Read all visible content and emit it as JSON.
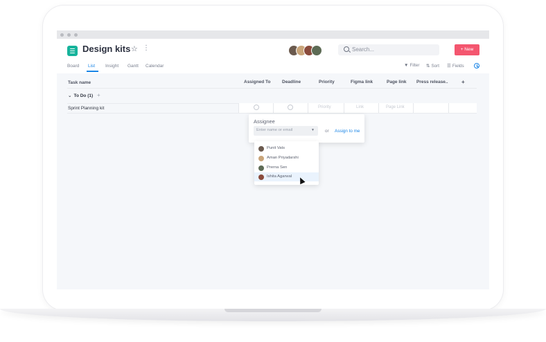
{
  "app": {
    "title": "Design kits",
    "search_placeholder": "Search...",
    "new_button": "+ New",
    "accent_color": "#1a85e6",
    "brand_color": "#16b39b",
    "new_button_color": "#f4566f"
  },
  "tabs": [
    {
      "label": "Board"
    },
    {
      "label": "List"
    },
    {
      "label": "Insight"
    },
    {
      "label": "Gantt"
    },
    {
      "label": "Calendar"
    }
  ],
  "toolbar": {
    "filter": "Filter",
    "sort": "Sort",
    "fields": "Fields"
  },
  "table": {
    "columns": [
      "Task name",
      "Assigned To",
      "Deadline",
      "Priority",
      "Figma link",
      "Page link",
      "Press release..",
      "+"
    ],
    "group": {
      "label": "To Do (1)",
      "add": "+"
    },
    "rows": [
      {
        "task": "Sprint Planning kit",
        "priority": "Priority",
        "figma": "Link",
        "page": "Page Link"
      }
    ]
  },
  "assignee_popover": {
    "title": "Assignee",
    "input_placeholder": "Enter name or email",
    "or": "or",
    "assign_to_me": "Assign to me"
  },
  "assignee_options": [
    {
      "name": "Punit Vats"
    },
    {
      "name": "Aman Priyadarshi"
    },
    {
      "name": "Prerna Sen"
    },
    {
      "name": "Ishita Agarwal",
      "highlighted": true
    }
  ]
}
